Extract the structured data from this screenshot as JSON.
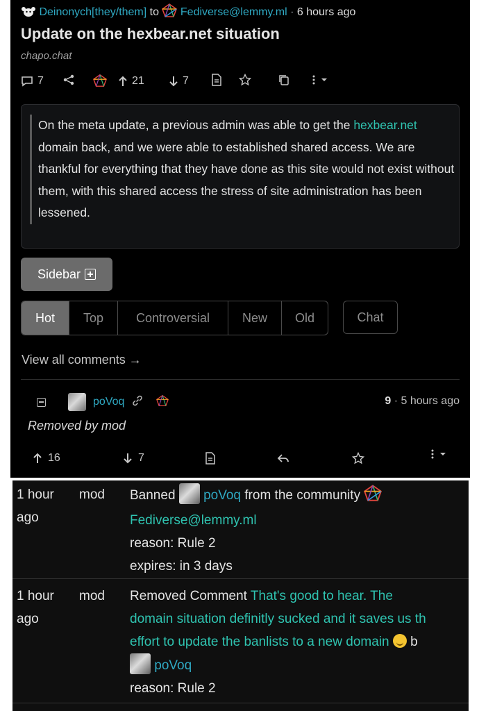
{
  "post": {
    "author": "Deinonych[they/them]",
    "to_word": "to",
    "community": "Fediverse@lemmy.ml",
    "separator": "·",
    "time": "6 hours ago",
    "title": "Update on the hexbear.net situation",
    "domain": "chapo.chat",
    "comment_count": "7",
    "upvotes": "21",
    "downvotes": "7",
    "body_link": "hexbear.net",
    "body_before": "On the meta update, a previous admin was able to get the ",
    "body_after": " domain back, and we were able to established shared access. We are thankful for everything that they have done as this site would not exist without them, with this shared access the stress of site administration has been lessened."
  },
  "controls": {
    "sidebar_label": "Sidebar",
    "sort_options": [
      "Hot",
      "Top",
      "Controversial",
      "New",
      "Old"
    ],
    "active_sort": "Hot",
    "chat_label": "Chat",
    "view_all": "View all comments →"
  },
  "comment": {
    "author": "poVoq",
    "score": "9",
    "separator": "·",
    "time": "5 hours ago",
    "body": "Removed by mod",
    "upvotes": "16",
    "downvotes": "7"
  },
  "modlog": [
    {
      "when": "1 hour ago",
      "who": "mod",
      "action": "Banned",
      "user": "poVoq",
      "middle": "from the community",
      "community": "Fediverse@lemmy.ml",
      "reason": "reason: Rule 2",
      "expires": "expires: in 3 days"
    },
    {
      "when": "1 hour ago",
      "who": "mod",
      "action": "Removed Comment",
      "line1": "That's good to hear. The",
      "line2": "domain situation definitly sucked and it saves us th",
      "line3": "effort to update the banlists to a new domain",
      "line3_tail": "b",
      "user": "poVoq",
      "reason": "reason: Rule 2"
    }
  ],
  "colors": {
    "link": "#2fa9c3",
    "teal": "#2fc3b0",
    "active_sort_bg": "#6b6b6b"
  }
}
